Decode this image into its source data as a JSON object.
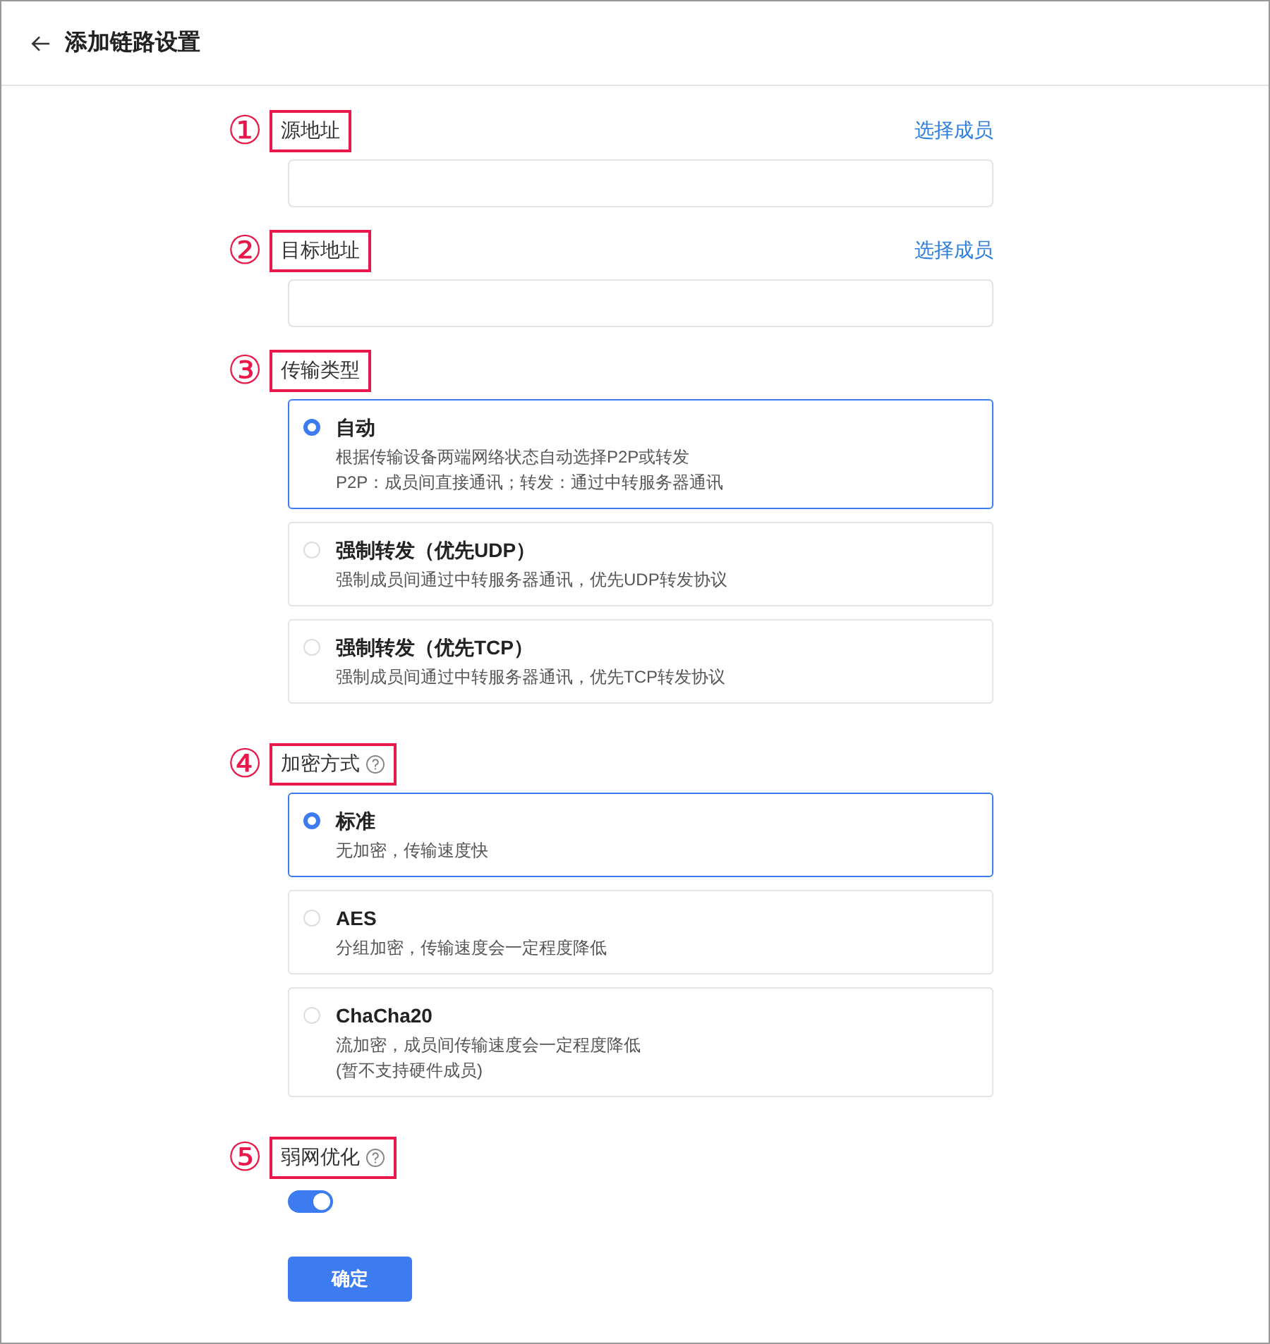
{
  "header": {
    "title": "添加链路设置"
  },
  "sections": [
    {
      "kind": "address",
      "marker": "①",
      "label": "源地址",
      "highlighted": true,
      "help": false,
      "link": "选择成员"
    },
    {
      "kind": "address",
      "marker": "②",
      "label": "目标地址",
      "highlighted": true,
      "help": false,
      "link": "选择成员"
    },
    {
      "kind": "radio",
      "marker": "③",
      "label": "传输类型",
      "highlighted": true,
      "help": false,
      "options": [
        {
          "title": "自动",
          "lines": [
            "根据传输设备两端网络状态自动选择P2P或转发",
            "P2P：成员间直接通讯；转发：通过中转服务器通讯"
          ],
          "selected": true
        },
        {
          "title": "强制转发（优先UDP）",
          "lines": [
            "强制成员间通过中转服务器通讯，优先UDP转发协议"
          ],
          "selected": false
        },
        {
          "title": "强制转发（优先TCP）",
          "lines": [
            "强制成员间通过中转服务器通讯，优先TCP转发协议"
          ],
          "selected": false
        }
      ]
    },
    {
      "kind": "radio",
      "marker": "④",
      "label": "加密方式",
      "highlighted": true,
      "help": true,
      "options": [
        {
          "title": "标准",
          "lines": [
            "无加密，传输速度快"
          ],
          "selected": true
        },
        {
          "title": "AES",
          "lines": [
            "分组加密，传输速度会一定程度降低"
          ],
          "selected": false
        },
        {
          "title": "ChaCha20",
          "lines": [
            "流加密，成员间传输速度会一定程度降低",
            "(暂不支持硬件成员)"
          ],
          "selected": false
        }
      ]
    },
    {
      "kind": "toggle",
      "marker": "⑤",
      "label": "弱网优化",
      "highlighted": true,
      "help": true,
      "on": true
    }
  ],
  "confirm": "确定"
}
